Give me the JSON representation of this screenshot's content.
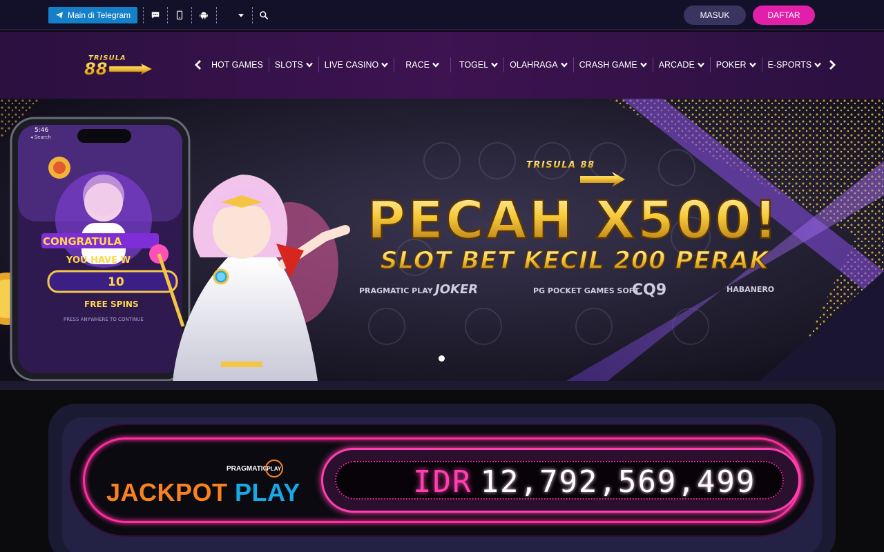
{
  "topbar": {
    "telegram_label": "Main di Telegram",
    "icons": [
      "chat-icon",
      "mobile-icon",
      "android-icon",
      "dropdown-icon",
      "search-icon"
    ],
    "login_label": "MASUK",
    "register_label": "DAFTAR"
  },
  "nav": {
    "logo_text": "TRISULA 88",
    "items": [
      {
        "label": "HOT GAMES",
        "dropdown": false
      },
      {
        "label": "SLOTS",
        "dropdown": true
      },
      {
        "label": "LIVE CASINO",
        "dropdown": true
      },
      {
        "label": "RACE",
        "dropdown": true
      },
      {
        "label": "TOGEL",
        "dropdown": true
      },
      {
        "label": "OLAHRAGA",
        "dropdown": true
      },
      {
        "label": "CRASH GAME",
        "dropdown": true
      },
      {
        "label": "ARCADE",
        "dropdown": true
      },
      {
        "label": "POKER",
        "dropdown": true
      },
      {
        "label": "E-SPORTS",
        "dropdown": true
      }
    ]
  },
  "banner": {
    "brand": "TRISULA 88",
    "headline": "PECAH X500!",
    "subheadline": "SLOT BET KECIL 200 PERAK",
    "providers": [
      "PRAGMATIC PLAY",
      "JOKER",
      "PG POCKET GAMES SOFT",
      "CQ9",
      "HABANERO"
    ],
    "phone": {
      "time": "5:46",
      "back_label": "◂ Search",
      "congrats": "CONGRATULA",
      "you_have": "YOU HAVE W",
      "spins_number": "10",
      "free_spins": "FREE SPINS",
      "press_anywhere": "PRESS ANYWHERE TO CONTINUE"
    },
    "slides_total": 1,
    "active_slide": 1
  },
  "jackpot": {
    "provider_badge": "PRAGMATIC",
    "provider_badge_ring": "PLAY",
    "title_part1": "JACKPOT",
    "title_part2": "PLAY",
    "currency": "IDR",
    "amount": "12,792,569,499"
  },
  "colors": {
    "accent_pink": "#e21fa8",
    "telegram_blue": "#1480c8",
    "gold": "#f4c542",
    "orange": "#f7821f",
    "blue": "#19a8e6"
  }
}
